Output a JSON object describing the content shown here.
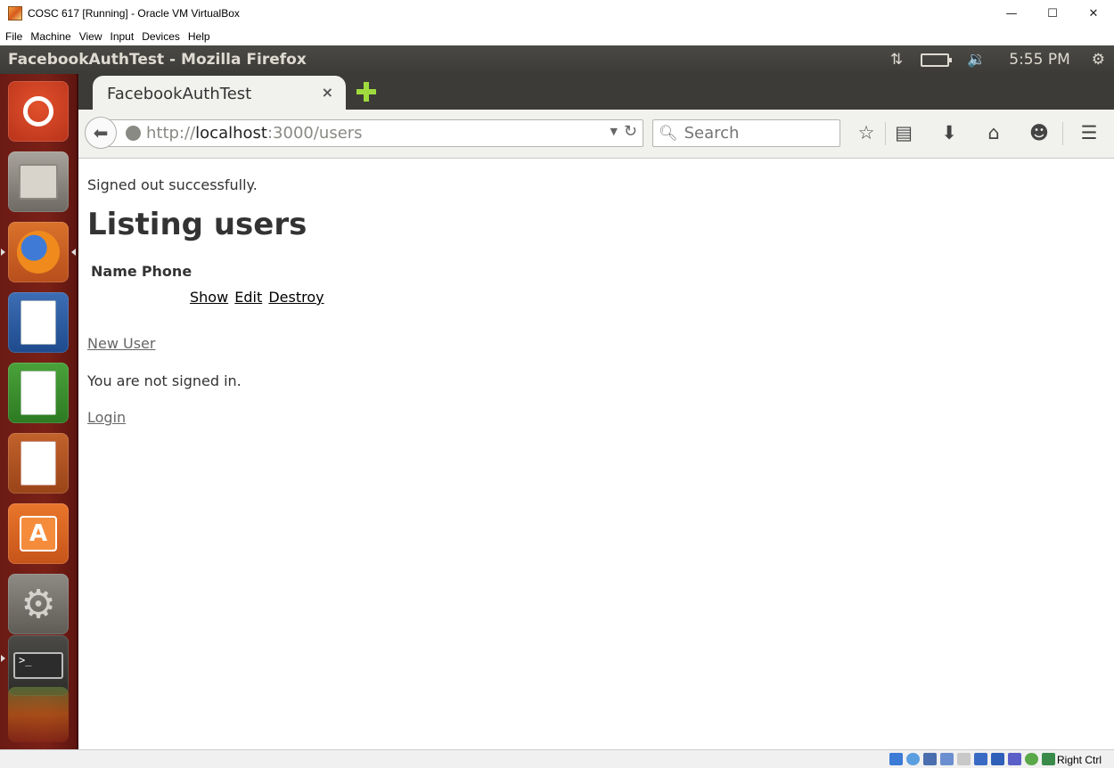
{
  "vbox": {
    "title": "COSC 617 [Running] - Oracle VM VirtualBox",
    "menu": [
      "File",
      "Machine",
      "View",
      "Input",
      "Devices",
      "Help"
    ],
    "minimize": "—",
    "maximize": "☐",
    "close": "✕",
    "host_key": "Right Ctrl"
  },
  "panel": {
    "window_title": "FacebookAuthTest - Mozilla Firefox",
    "clock": "5:55 PM"
  },
  "launcher": {
    "items": [
      "dash-home",
      "files",
      "firefox",
      "libreoffice-writer",
      "libreoffice-calc",
      "libreoffice-impress",
      "software-center",
      "system-settings",
      "terminal"
    ]
  },
  "browser": {
    "tab_title": "FacebookAuthTest",
    "tab_close": "×",
    "url_prefix": "http://",
    "url_host": "localhost",
    "url_rest": ":3000/users",
    "search_placeholder": "Search"
  },
  "page": {
    "notice": "Signed out successfully.",
    "title": "Listing users",
    "table_headers": [
      "Name",
      "Phone"
    ],
    "row_actions": [
      "Show",
      "Edit",
      "Destroy"
    ],
    "new_user_link": "New User",
    "status_text": "You are not signed in.",
    "login_link": "Login"
  },
  "colors": {
    "panel_bg": "#3c3b37",
    "launcher_bg": "#7a2117",
    "accent_plus": "#9fdb3d"
  }
}
